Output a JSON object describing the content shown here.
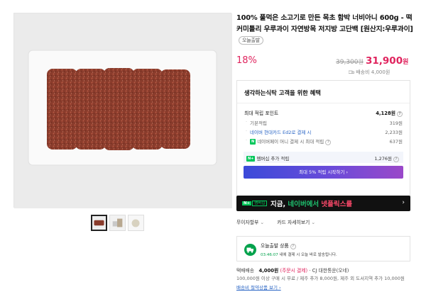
{
  "product": {
    "title": "100% 풀먹은 소고기로 만든 목초 함박 너비아니 600g - 떡커미틀리 우루과이 자연방목 저지방 고단백 [원산지:우루과이]",
    "tag": "오늘출발",
    "discount": "18%",
    "original_price": "39,300",
    "original_unit": "원",
    "sale_price": "31,900",
    "sale_unit": "원",
    "shipping_fee": "배송비 4,000원"
  },
  "benefit": {
    "title": "생각하는식탁 고객을 위한 혜택",
    "max_points_label": "최대 적립 포인트",
    "max_points_value": "4,128원",
    "rows": [
      {
        "label": "기본적립",
        "value": "319원"
      },
      {
        "label": "네이버 현대카드 Ed2로 결제 시",
        "value": "2,233원"
      },
      {
        "label": "네이버페이 머니 결제 시 최대 적립",
        "value": "637원"
      }
    ],
    "extra_label": "멤버십 추가 적립",
    "extra_value": "1,276원",
    "cta": "최대 5% 적립 시작하기 ›"
  },
  "banner": {
    "badge_n": "N+",
    "badge_text": "멤버십",
    "text_white1": "지금, ",
    "text_green": "네이버에서 ",
    "text_red": "넷플릭스를",
    "arrow": "›"
  },
  "links": {
    "interest_free": "무이자할부",
    "card_detail": "카드 자세히보기"
  },
  "today": {
    "title": "오늘출발 상품",
    "time": "03:46:07",
    "desc": " 내에 결제 시 오늘 바로 발송됩니다."
  },
  "shipping": {
    "label": "택배배송",
    "price": "4,000원",
    "condition": "(주문시 결제)",
    "carrier": "· CJ 대한통운(오네)",
    "detail": "100,000원 이상 구매 시 무료 / 제주 추가 8,000원, 제주 외 도서지역 추가 10,000원",
    "link": "배송비 절약상품 보기"
  }
}
